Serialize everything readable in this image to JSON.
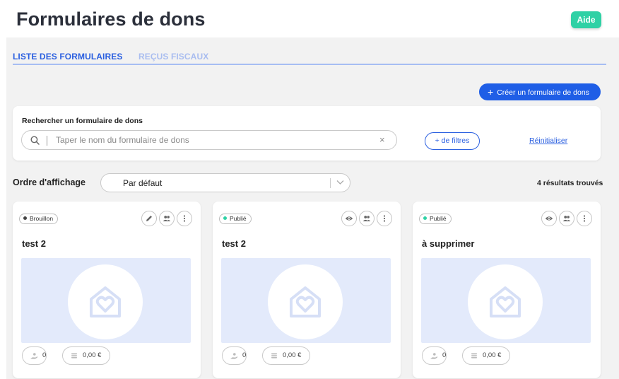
{
  "header": {
    "title": "Formulaires de dons",
    "help_label": "Aide"
  },
  "tabs": [
    {
      "label": "LISTE DES FORMULAIRES",
      "active": true
    },
    {
      "label": "REÇUS FISCAUX",
      "active": false
    }
  ],
  "create_button": {
    "icon": "plus-icon",
    "label": "Créer un formulaire de dons"
  },
  "search": {
    "label": "Rechercher un formulaire de dons",
    "value": "",
    "placeholder": "Taper le nom du formulaire de dons",
    "filters_label": "+ de filtres",
    "reset_label": "Réinitialiser"
  },
  "sort": {
    "label": "Ordre d'affichage",
    "selected": "Par défaut"
  },
  "results_count": "4 résultats trouvés",
  "colors": {
    "accent": "#1f5ee6",
    "help": "#2fd1a5",
    "published": "#2fd1a5",
    "draft": "#444444",
    "placeholder_bg": "#e3eafb"
  },
  "cards": [
    {
      "status": "Brouillon",
      "status_color": "#444444",
      "title": "test 2",
      "actions": [
        "edit-icon",
        "users-icon",
        "more-icon"
      ],
      "donors": "0",
      "amount": "0,00 €"
    },
    {
      "status": "Publié",
      "status_color": "#2fd1a5",
      "title": "test 2",
      "actions": [
        "eye-icon",
        "users-icon",
        "more-icon"
      ],
      "donors": "0",
      "amount": "0,00 €"
    },
    {
      "status": "Publié",
      "status_color": "#2fd1a5",
      "title": "à supprimer",
      "actions": [
        "eye-icon",
        "users-icon",
        "more-icon"
      ],
      "donors": "0",
      "amount": "0,00 €"
    }
  ]
}
